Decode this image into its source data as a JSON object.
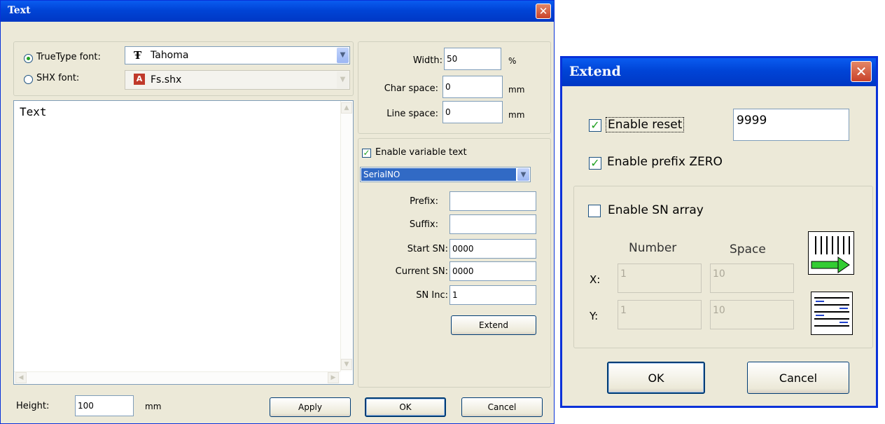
{
  "text_dialog": {
    "title": "Text",
    "close_glyph": "✕",
    "font": {
      "truetype_label": "TrueType font:",
      "truetype_value": "Tahoma",
      "truetype_icon_glyph": "Ŧ",
      "shx_label": "SHX font:",
      "shx_value": "Fs.shx",
      "shx_icon_glyph": "A"
    },
    "text_content": "Text",
    "metrics": {
      "width_label": "Width:",
      "width_value": "50",
      "width_unit": "%",
      "char_space_label": "Char space:",
      "char_space_value": "0",
      "char_space_unit": "mm",
      "line_space_label": "Line space:",
      "line_space_value": "0",
      "line_space_unit": "mm"
    },
    "variable": {
      "enable_label": "Enable variable text",
      "enable_checked": true,
      "type_value": "SerialNO",
      "prefix_label": "Prefix:",
      "prefix_value": "",
      "suffix_label": "Suffix:",
      "suffix_value": "",
      "start_sn_label": "Start SN:",
      "start_sn_value": "0000",
      "current_sn_label": "Current SN:",
      "current_sn_value": "0000",
      "sn_inc_label": "SN Inc:",
      "sn_inc_value": "1",
      "extend_label": "Extend"
    },
    "height_label": "Height:",
    "height_value": "100",
    "height_unit": "mm",
    "apply_label": "Apply",
    "ok_label": "OK",
    "cancel_label": "Cancel"
  },
  "extend_dialog": {
    "title": "Extend",
    "close_glyph": "✕",
    "enable_reset_label": "Enable reset",
    "enable_reset_checked": true,
    "reset_value": "9999",
    "enable_prefix_zero_label": "Enable prefix ZERO",
    "enable_prefix_zero_checked": true,
    "sn_array": {
      "enable_label": "Enable SN array",
      "enable_checked": false,
      "number_header": "Number",
      "space_header": "Space",
      "x_label": "X:",
      "x_number": "1",
      "x_space": "10",
      "y_label": "Y:",
      "y_number": "1",
      "y_space": "10"
    },
    "ok_label": "OK",
    "cancel_label": "Cancel"
  },
  "colors": {
    "title_bar": "#0044d6",
    "dialog_bg": "#ece9d8",
    "selection": "#316ac5",
    "check_mark": "#21a121",
    "arrow_green": "#33cc33"
  }
}
